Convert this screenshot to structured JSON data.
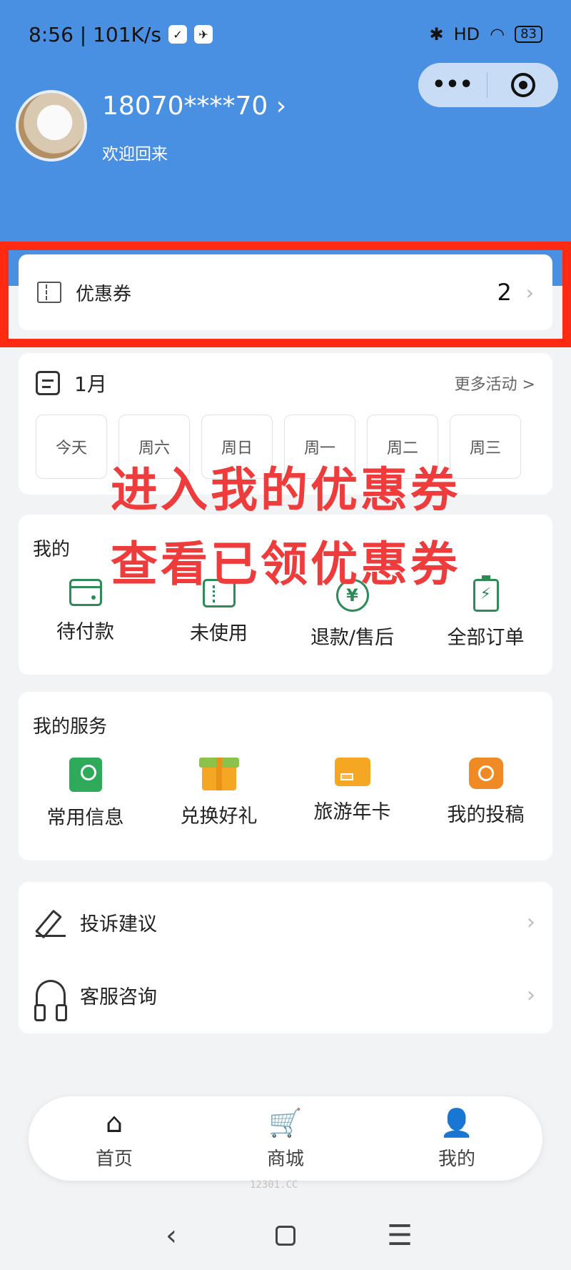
{
  "status_bar": {
    "time_speed": "8:56 | 101K/s",
    "battery": "83",
    "signal": "HD"
  },
  "capsule": {
    "more_label": "•••"
  },
  "profile": {
    "phone": "18070****70 ›",
    "welcome": "欢迎回来"
  },
  "coupon": {
    "label": "优惠券",
    "count": "2",
    "chevron": "›"
  },
  "calendar": {
    "month": "1月",
    "more": "更多活动 >",
    "days": [
      "今天",
      "周六",
      "周日",
      "周一",
      "周二",
      "周三"
    ]
  },
  "overlay": {
    "line1": "进入我的优惠券",
    "line2": "查看已领优惠券"
  },
  "orders": {
    "title": "我的",
    "items": [
      {
        "label": "待付款",
        "icon": "wallet-icon"
      },
      {
        "label": "未使用",
        "icon": "ticket-icon"
      },
      {
        "label": "退款/售后",
        "icon": "refund-icon"
      },
      {
        "label": "全部订单",
        "icon": "order-icon"
      }
    ]
  },
  "services": {
    "title": "我的服务",
    "items": [
      {
        "label": "常用信息",
        "icon": "contact-book-icon"
      },
      {
        "label": "兑换好礼",
        "icon": "gift-icon"
      },
      {
        "label": "旅游年卡",
        "icon": "card-icon"
      },
      {
        "label": "我的投稿",
        "icon": "camera-icon"
      }
    ]
  },
  "menu": {
    "items": [
      {
        "label": "投诉建议",
        "icon": "pen-icon",
        "chevron": "›"
      },
      {
        "label": "客服咨询",
        "icon": "headset-icon",
        "chevron": "›"
      }
    ]
  },
  "tabbar": {
    "items": [
      {
        "label": "首页",
        "glyph": "⌂"
      },
      {
        "label": "商城",
        "glyph": "🛒"
      },
      {
        "label": "我的",
        "glyph": "👤"
      }
    ]
  },
  "watermark": "12301.CC",
  "navbar": {
    "back": "‹",
    "menu": "☰"
  },
  "colors": {
    "header": "#4a90e2",
    "highlight": "#ff2a12",
    "overlay_text": "#ee3b3b",
    "accent_green": "#2e8b57"
  }
}
